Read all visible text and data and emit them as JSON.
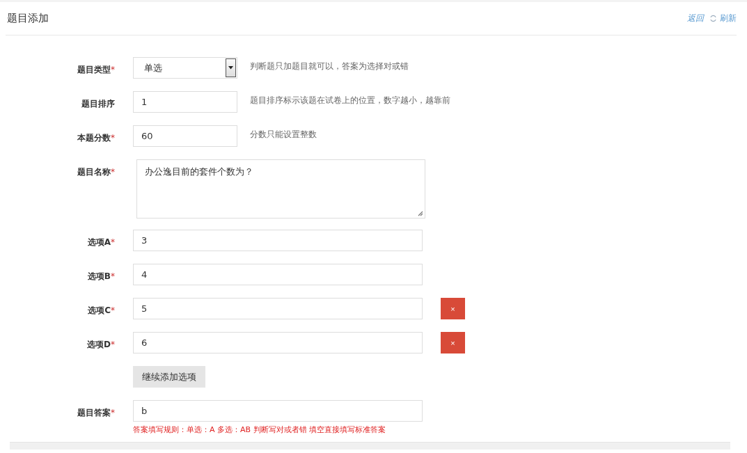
{
  "header": {
    "title": "题目添加",
    "back_link": "返回",
    "refresh_link": "刷新"
  },
  "rows": [
    {
      "kind": "select",
      "label": "题目类型",
      "required_mark": "*",
      "value": "单选",
      "hint": "判断题只加题目就可以，答案为选择对或错"
    },
    {
      "kind": "short",
      "label": "题目排序",
      "value": "1",
      "hint": "题目排序标示该题在试卷上的位置，数字越小，越靠前"
    },
    {
      "kind": "short",
      "label": "本题分数",
      "required_mark": "*",
      "value": "60",
      "hint": "分数只能设置整数"
    },
    {
      "kind": "textarea",
      "label": "题目名称",
      "required_mark": "*",
      "value": "办公逸目前的套件个数为？"
    },
    {
      "kind": "long",
      "label": "选项A",
      "required_mark": "*",
      "value": "3"
    },
    {
      "kind": "long",
      "label": "选项B",
      "required_mark": "*",
      "value": "4"
    },
    {
      "kind": "long",
      "label": "选项C",
      "required_mark": "*",
      "value": "5",
      "remove_button": "×"
    },
    {
      "kind": "long",
      "label": "选项D",
      "required_mark": "*",
      "value": "6",
      "remove_button": "×"
    }
  ],
  "add_option_button": "继续添加选项",
  "answer": {
    "label": "题目答案",
    "required_mark": "*",
    "value": "b",
    "rule": "答案填写规则：单选：A 多选：AB 判断写对或者错 填空直接填写标准答案"
  }
}
